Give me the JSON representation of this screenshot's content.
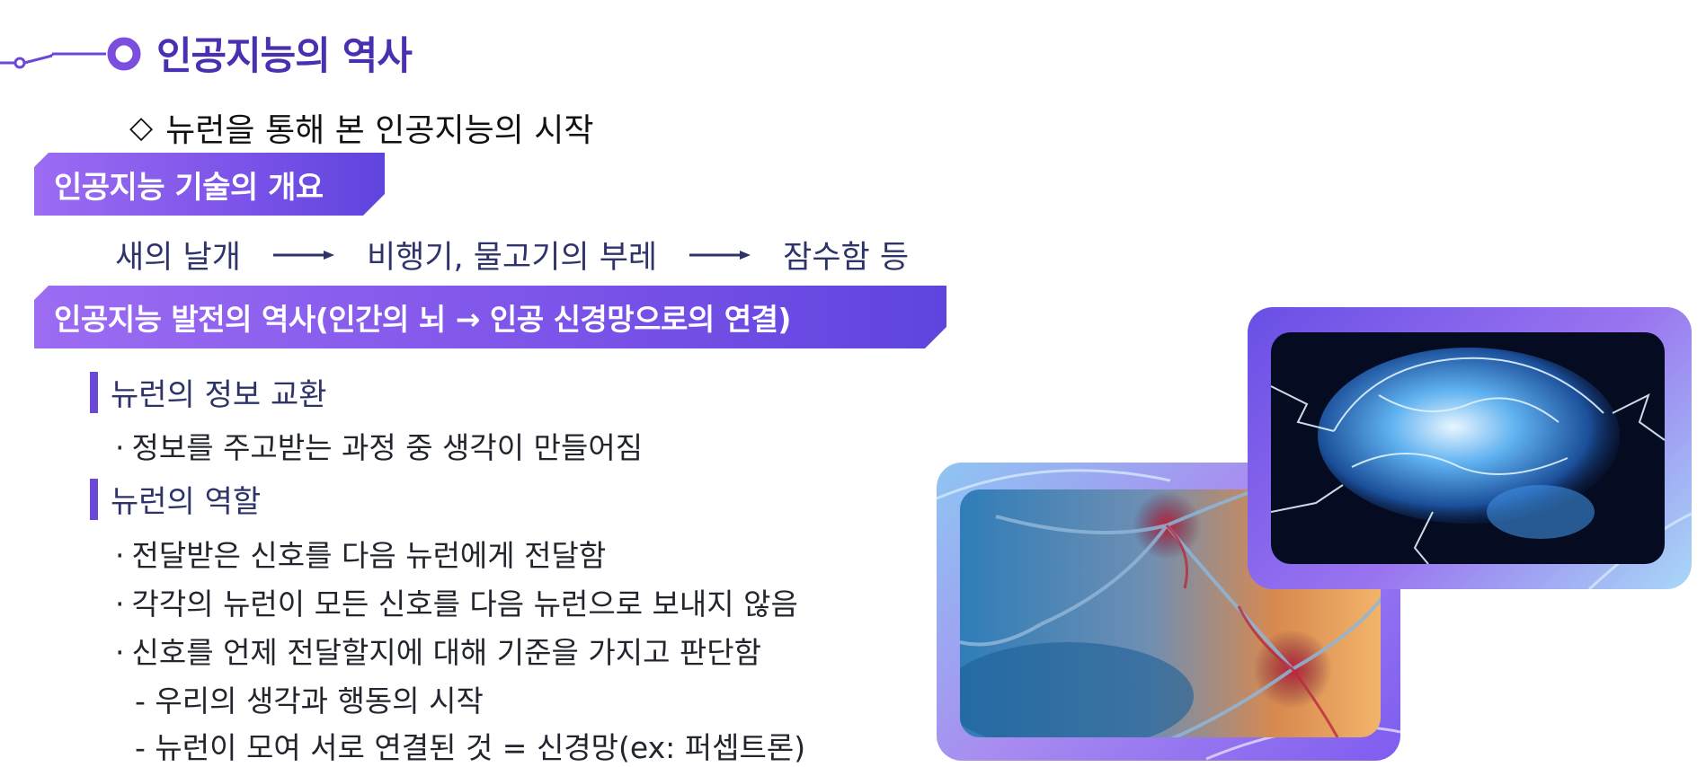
{
  "header": {
    "title": "인공지능의 역사",
    "subtitle_icon": "diamond-outline-icon",
    "subtitle": "뉴런을 통해 본 인공지능의 시작"
  },
  "banners": {
    "overview": "인공지능 기술의 개요",
    "history": "인공지능 발전의 역사(인간의 뇌 → 인공 신경망으로의 연결)"
  },
  "flow": {
    "step1": "새의 날개",
    "step2": "비행기, 물고기의 부레",
    "step3": "잠수함 등",
    "arrow_icon": "arrow-right-icon"
  },
  "sections": [
    {
      "heading": "뉴런의 정보 교환",
      "items": [
        "정보를 주고받는 과정 중 생각이 만들어짐"
      ]
    },
    {
      "heading": "뉴런의 역할",
      "items": [
        "전달받은 신호를 다음 뉴런에게 전달함",
        "각각의 뉴런이 모든 신호를 다음 뉴런으로 보내지 않음",
        "신호를 언제 전달할지에 대해 기준을 가지고 판단함"
      ],
      "subitems": [
        "- 우리의 생각과 행동의 시작",
        "- 뉴런이 모여 서로 연결된 것 = 신경망(ex: 퍼셉트론)"
      ]
    }
  ],
  "colors": {
    "title": "#4a2fb0",
    "banner_start": "#9c6cf2",
    "banner_end": "#5f44dd",
    "accent_bar": "#6b48d6",
    "flow_text": "#2e3369"
  }
}
